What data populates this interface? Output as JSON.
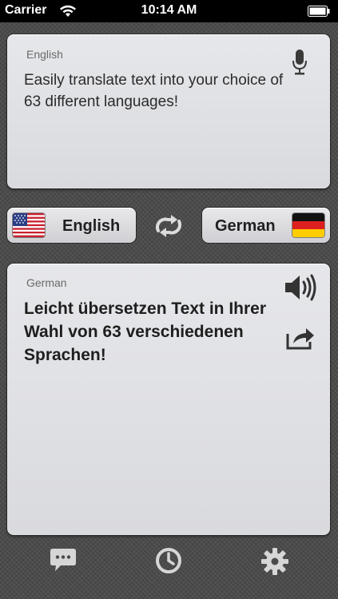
{
  "status_bar": {
    "carrier": "Carrier",
    "time": "10:14 AM",
    "icons": [
      "wifi-icon",
      "battery-icon"
    ]
  },
  "source": {
    "language_label": "English",
    "text": "Easily translate text into your choice of 63 different languages!",
    "icon": "microphone-icon"
  },
  "language_selector": {
    "from_label": "English",
    "to_label": "German",
    "from_flag": "us-flag",
    "to_flag": "germany-flag",
    "swap_icon": "swap-arrows-icon"
  },
  "translation": {
    "language_label": "German",
    "text": "Leicht übersetzen Text in Ihrer Wahl von 63 verschiedenen Sprachen!",
    "icons": [
      "speaker-icon",
      "share-icon"
    ]
  },
  "tab_bar": {
    "items": [
      "chat-bubble-icon",
      "history-clock-icon",
      "settings-gear-icon"
    ]
  },
  "colors": {
    "panel": "#dfe0e3",
    "background": "#4a4a4a",
    "status_bar": "#000000"
  }
}
